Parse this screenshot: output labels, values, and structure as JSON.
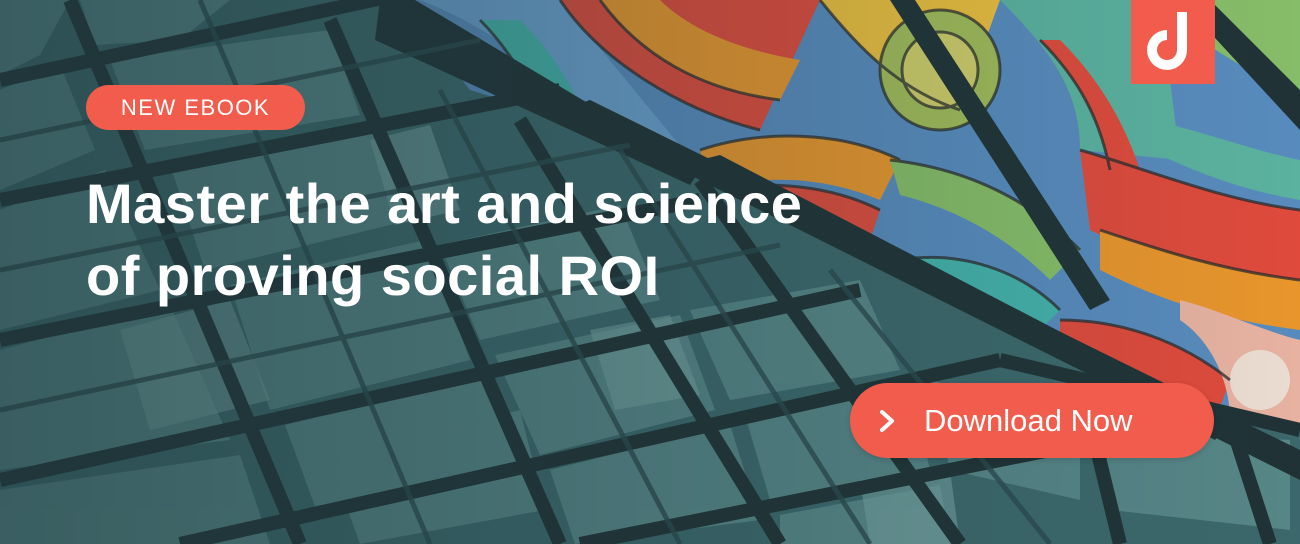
{
  "colors": {
    "accent": "#f25c4c",
    "text": "#ffffff",
    "glass_overlay": "#2f5256"
  },
  "logo": {
    "icon": "brand-logo-icon"
  },
  "badge": {
    "label": "NEW EBOOK"
  },
  "headline": {
    "line1": "Master the art and science",
    "line2": "of proving social ROI"
  },
  "cta": {
    "label": "Download Now",
    "icon": "chevron-right-icon"
  }
}
